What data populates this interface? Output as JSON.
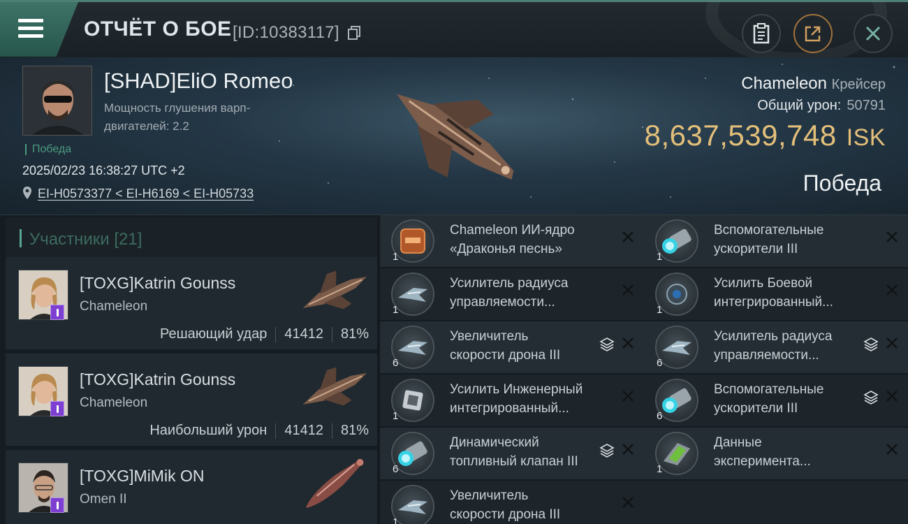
{
  "header": {
    "title": "ОТЧЁТ О БОЕ",
    "report_id": "[ID:10383117]"
  },
  "victim": {
    "name": "[SHAD]EliO Romeo",
    "jam_label": "Мощность глушения варп-двигателей: 2.2",
    "status": "Победа",
    "timestamp": "2025/02/23 16:38:27 UTC +2",
    "location": "EI-H0573377 < EI-H6169 < EI-H05733",
    "ship_name": "Chameleon",
    "ship_class": "Крейсер",
    "total_damage_label": "Общий урон:",
    "total_damage": "50791",
    "isk_value": "8,637,539,748",
    "isk_unit": "ISK",
    "result": "Победа"
  },
  "participants": {
    "title": "Участники [21]",
    "items": [
      {
        "name": "[TOXG]Katrin Gounss",
        "ship": "Chameleon",
        "role": "Решающий удар",
        "damage": "41412",
        "percent": "81%"
      },
      {
        "name": "[TOXG]Katrin Gounss",
        "ship": "Chameleon",
        "role": "Наибольший урон",
        "damage": "41412",
        "percent": "81%"
      },
      {
        "name": "[TOXG]MiMik ON",
        "ship": "Omen II",
        "role": "",
        "damage": "",
        "percent": ""
      }
    ]
  },
  "items": [
    {
      "label": "Chameleon ИИ-ядро\n«Драконья песнь»",
      "qty": "1",
      "icon": "ai-core-icon",
      "stack": false
    },
    {
      "label": "Вспомогательные\nускорители III",
      "qty": "1",
      "icon": "booster-icon",
      "stack": false
    },
    {
      "label": "Усилитель радиуса\nуправляемости...",
      "qty": "1",
      "icon": "drone-link-icon",
      "stack": false
    },
    {
      "label": "Усилить Боевой\nинтегрированный...",
      "qty": "1",
      "icon": "combat-module-icon",
      "stack": false
    },
    {
      "label": "Увеличитель\nскорости дрона III",
      "qty": "6",
      "icon": "drone-speed-icon",
      "stack": true
    },
    {
      "label": "Усилитель радиуса\nуправляемости...",
      "qty": "6",
      "icon": "drone-link-icon",
      "stack": true
    },
    {
      "label": "Усилить Инженерный\n интегрированный...",
      "qty": "1",
      "icon": "engineering-module-icon",
      "stack": false
    },
    {
      "label": "Вспомогательные\nускорители III",
      "qty": "6",
      "icon": "booster-icon",
      "stack": true
    },
    {
      "label": "Динамический\nтопливный клапан III",
      "qty": "6",
      "icon": "fuel-valve-icon",
      "stack": true
    },
    {
      "label": "Данные\nэксперимента...",
      "qty": "1",
      "icon": "experiment-data-icon",
      "stack": false
    },
    {
      "label": "Увеличитель\nскорости дрона III",
      "qty": "1",
      "icon": "drone-speed-icon",
      "stack": false
    }
  ]
}
